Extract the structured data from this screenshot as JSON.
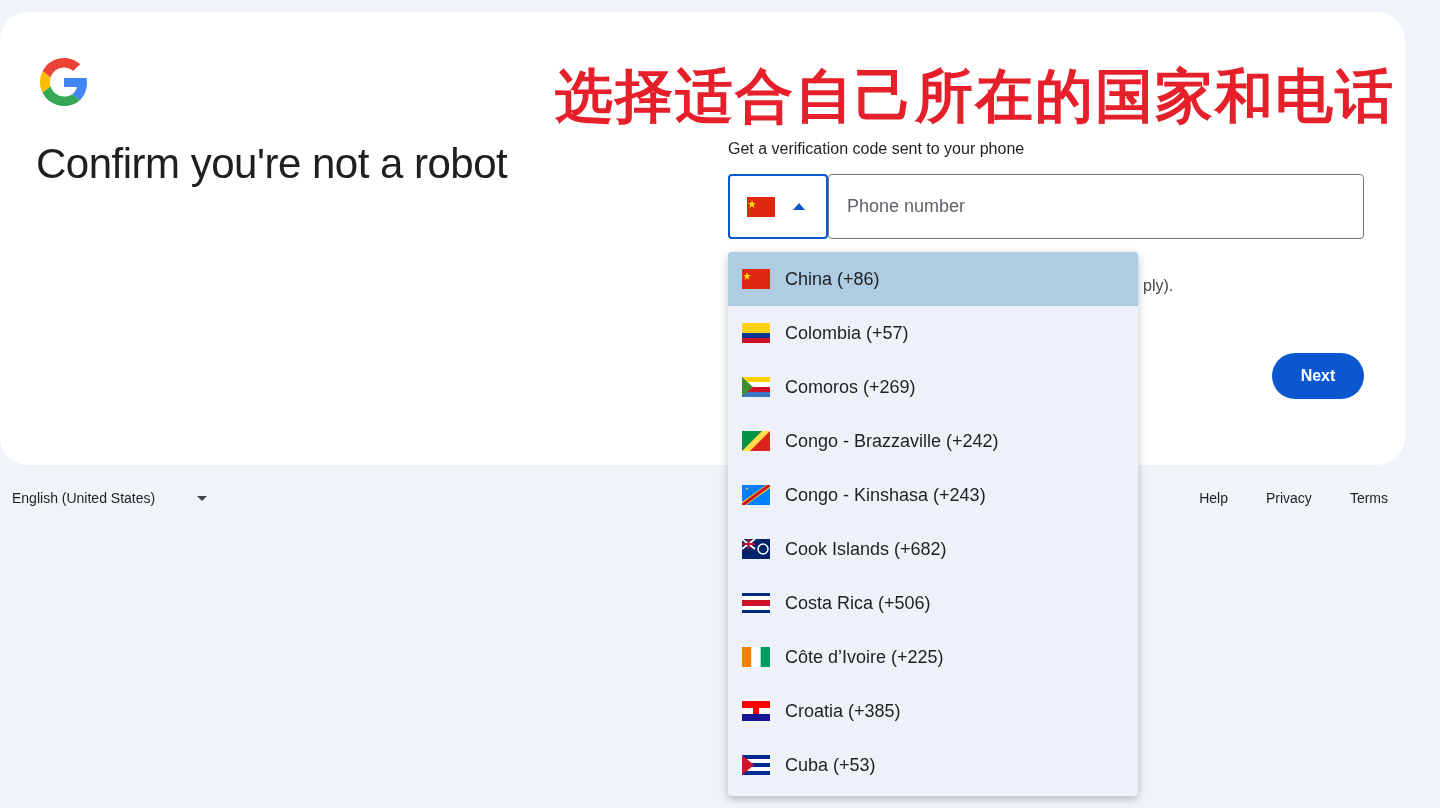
{
  "annotation": "选择适合自己所在的国家和电话",
  "heading": "Confirm you're not a robot",
  "phone_prompt": "Get a verification code sent to your phone",
  "country_select": {
    "expanded": true
  },
  "phone_field": {
    "placeholder": "Phone number"
  },
  "partial_note": "ply).",
  "next_button": "Next",
  "country_menu": [
    {
      "label": "China (+86)",
      "selected": true
    },
    {
      "label": "Colombia (+57)",
      "selected": false
    },
    {
      "label": "Comoros (+269)",
      "selected": false
    },
    {
      "label": "Congo - Brazzaville (+242)",
      "selected": false
    },
    {
      "label": "Congo - Kinshasa (+243)",
      "selected": false
    },
    {
      "label": "Cook Islands (+682)",
      "selected": false
    },
    {
      "label": "Costa Rica (+506)",
      "selected": false
    },
    {
      "label": "Côte d’Ivoire (+225)",
      "selected": false
    },
    {
      "label": "Croatia (+385)",
      "selected": false
    },
    {
      "label": "Cuba (+53)",
      "selected": false
    }
  ],
  "footer": {
    "language": "English (United States)",
    "links": [
      "Help",
      "Privacy",
      "Terms"
    ]
  }
}
